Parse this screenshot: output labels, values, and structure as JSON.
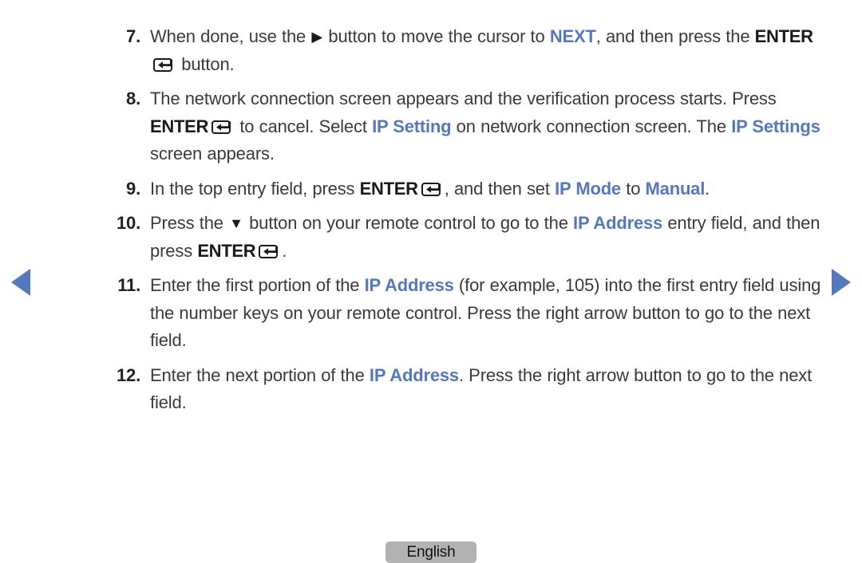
{
  "accent_color": "#5577bb",
  "text_color": "#3a3a3a",
  "nav": {
    "prev_label": "Previous page",
    "next_label": "Next page",
    "prev_icon": "triangle-left-icon",
    "next_icon": "triangle-right-icon"
  },
  "footer": {
    "language_label": "English"
  },
  "glyphs": {
    "right_arrow": "▶",
    "down_arrow": "▼",
    "enter_icon_name": "enter-key-icon"
  },
  "steps": [
    {
      "number": "7.",
      "segments": [
        {
          "t": "text",
          "v": "When done, use the "
        },
        {
          "t": "glyph",
          "v": "▶",
          "name": "right-arrow-glyph"
        },
        {
          "t": "text",
          "v": " button to move the cursor to "
        },
        {
          "t": "blue",
          "v": "NEXT"
        },
        {
          "t": "text",
          "v": ", and then press the "
        },
        {
          "t": "bold",
          "v": "ENTER"
        },
        {
          "t": "enter",
          "v": ""
        },
        {
          "t": "text",
          "v": " button."
        }
      ]
    },
    {
      "number": "8.",
      "segments": [
        {
          "t": "text",
          "v": "The network connection screen appears and the verification process starts. Press "
        },
        {
          "t": "bold",
          "v": "ENTER"
        },
        {
          "t": "enter",
          "v": ""
        },
        {
          "t": "text",
          "v": " to cancel. Select "
        },
        {
          "t": "blue",
          "v": "IP Setting"
        },
        {
          "t": "text",
          "v": " on network connection screen. The "
        },
        {
          "t": "blue",
          "v": "IP Settings"
        },
        {
          "t": "text",
          "v": " screen appears."
        }
      ]
    },
    {
      "number": "9.",
      "segments": [
        {
          "t": "text",
          "v": "In the top entry field, press "
        },
        {
          "t": "bold",
          "v": "ENTER"
        },
        {
          "t": "enter",
          "v": ""
        },
        {
          "t": "text",
          "v": ", and then set "
        },
        {
          "t": "blue",
          "v": "IP Mode"
        },
        {
          "t": "text",
          "v": " to "
        },
        {
          "t": "blue",
          "v": "Manual"
        },
        {
          "t": "text",
          "v": "."
        }
      ]
    },
    {
      "number": "10.",
      "segments": [
        {
          "t": "text",
          "v": "Press the "
        },
        {
          "t": "glyph",
          "v": "▼",
          "name": "down-arrow-glyph"
        },
        {
          "t": "text",
          "v": " button on your remote control to go to the "
        },
        {
          "t": "blue",
          "v": "IP Address"
        },
        {
          "t": "text",
          "v": " entry field, and then press "
        },
        {
          "t": "bold",
          "v": "ENTER"
        },
        {
          "t": "enter",
          "v": ""
        },
        {
          "t": "text",
          "v": "."
        }
      ]
    },
    {
      "number": "11.",
      "segments": [
        {
          "t": "text",
          "v": "Enter the first portion of the "
        },
        {
          "t": "blue",
          "v": "IP Address"
        },
        {
          "t": "text",
          "v": " (for example, 105) into the first entry field using the number keys on your remote control. Press the right arrow button to go to the next field."
        }
      ]
    },
    {
      "number": "12.",
      "segments": [
        {
          "t": "text",
          "v": "Enter the next portion of the "
        },
        {
          "t": "blue",
          "v": "IP Address"
        },
        {
          "t": "text",
          "v": ". Press the right arrow button to go to the next field."
        }
      ]
    }
  ]
}
